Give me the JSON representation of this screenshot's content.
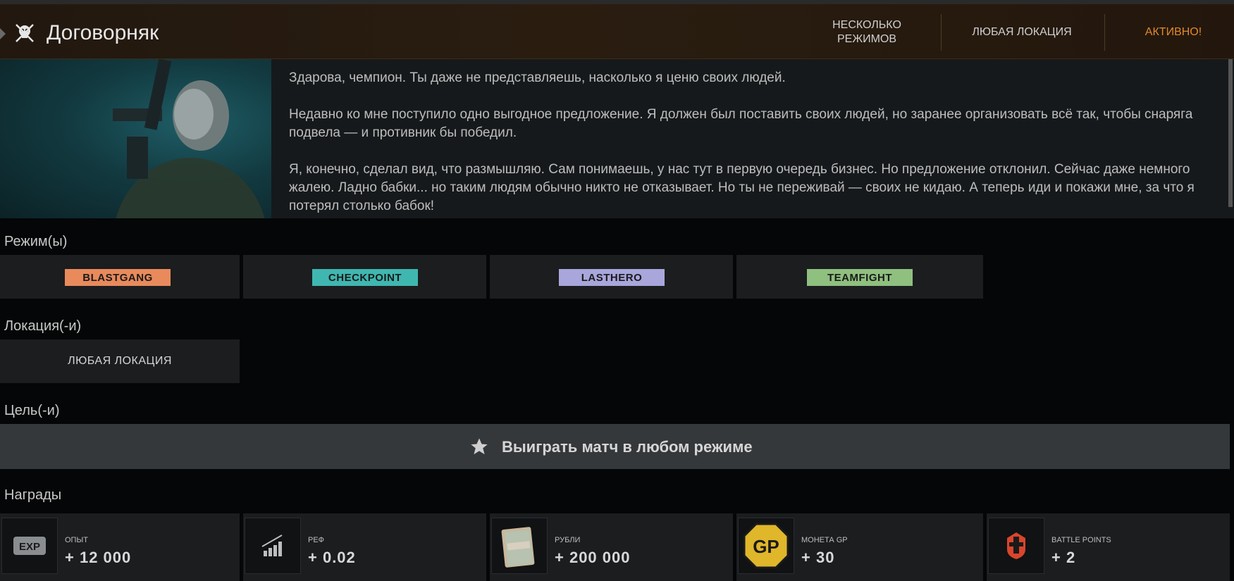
{
  "header": {
    "title": "Договорняк",
    "modes": "НЕСКОЛЬКО РЕЖИМОВ",
    "location": "ЛЮБАЯ ЛОКАЦИЯ",
    "status": "АКТИВНО!"
  },
  "description": {
    "paragraphs": [
      "Здарова, чемпион. Ты даже не представляешь, насколько я ценю своих людей.",
      "Недавно ко мне поступило одно выгодное предложение. Я должен был поставить своих людей, но заранее организовать всё так, чтобы снаряга подвела — и противник бы победил.",
      "Я, конечно, сделал вид, что размышляю. Сам понимаешь, у нас тут в первую очередь бизнес. Но предложение отклонил. Сейчас даже немного жалею. Ладно бабки... но таким людям обычно никто не отказывает. Но ты не переживай — своих не кидаю. А теперь иди и покажи мне, за что я потерял столько бабок!"
    ]
  },
  "modes_section": {
    "label": "Режим(ы)",
    "items": [
      {
        "name": "BLASTGANG",
        "color": "#e98a5c"
      },
      {
        "name": "CHECKPOINT",
        "color": "#3fb7b0"
      },
      {
        "name": "LASTHERO",
        "color": "#a9a6dc"
      },
      {
        "name": "TEAMFIGHT",
        "color": "#8fc07f"
      }
    ]
  },
  "location_section": {
    "label": "Локация(-и)",
    "value": "ЛЮБАЯ ЛОКАЦИЯ"
  },
  "goal_section": {
    "label": "Цель(-и)",
    "goal": "Выиграть матч в любом режиме"
  },
  "rewards_section": {
    "label": "Награды",
    "items": [
      {
        "label": "ОПЫТ",
        "value": "+ 12 000",
        "icon": "exp-icon"
      },
      {
        "label": "РЕФ",
        "value": "+ 0.02",
        "icon": "ref-icon"
      },
      {
        "label": "РУБЛИ",
        "value": "+ 200 000",
        "icon": "rubles-icon"
      },
      {
        "label": "МОНЕТА GP",
        "value": "+ 30",
        "icon": "gp-coin-icon"
      },
      {
        "label": "BATTLE POINTS",
        "value": "+ 2",
        "icon": "battle-points-icon"
      }
    ]
  },
  "icons": {
    "exp_text": "EXP",
    "gp_text": "GP"
  }
}
